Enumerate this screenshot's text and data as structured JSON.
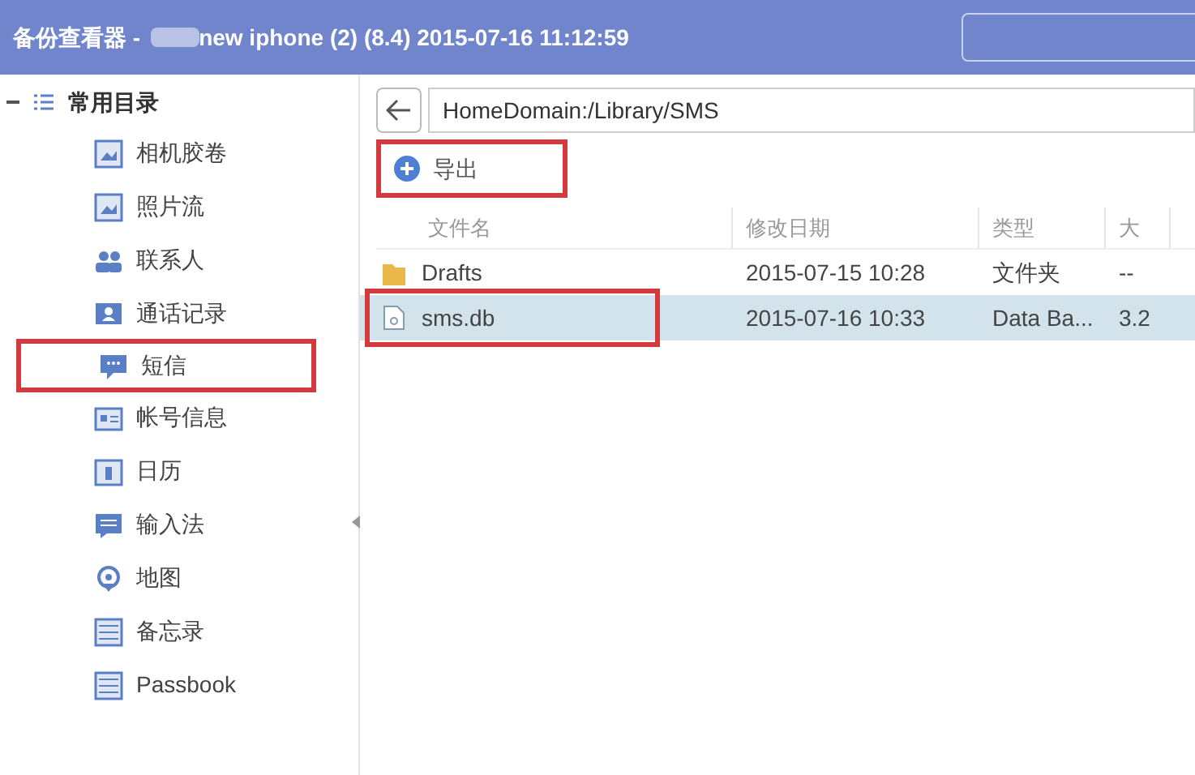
{
  "window": {
    "title_prefix": "备份查看器 -",
    "title_rest": "new iphone (2) (8.4) 2015-07-16 11:12:59"
  },
  "sidebar": {
    "group": {
      "label": "常用目录",
      "expanded": true
    },
    "items": [
      {
        "label": "相机胶卷",
        "highlighted": false
      },
      {
        "label": "照片流",
        "highlighted": false
      },
      {
        "label": "联系人",
        "highlighted": false
      },
      {
        "label": "通话记录",
        "highlighted": false
      },
      {
        "label": "短信",
        "highlighted": true
      },
      {
        "label": "帐号信息",
        "highlighted": false
      },
      {
        "label": "日历",
        "highlighted": false
      },
      {
        "label": "输入法",
        "highlighted": false
      },
      {
        "label": "地图",
        "highlighted": false
      },
      {
        "label": "备忘录",
        "highlighted": false
      },
      {
        "label": "Passbook",
        "highlighted": false
      }
    ]
  },
  "path": "HomeDomain:/Library/SMS",
  "toolbar": {
    "export": {
      "label": "导出",
      "highlighted": true
    }
  },
  "table": {
    "columns": [
      "文件名",
      "修改日期",
      "类型",
      "大"
    ],
    "rows": [
      {
        "kind": "folder",
        "cells": [
          "Drafts",
          "2015-07-15 10:28",
          "文件夹",
          "--"
        ],
        "selected": false,
        "highlighted": false
      },
      {
        "kind": "file",
        "cells": [
          "sms.db",
          "2015-07-16 10:33",
          "Data Ba...",
          "3.2"
        ],
        "selected": true,
        "highlighted": true
      }
    ]
  }
}
